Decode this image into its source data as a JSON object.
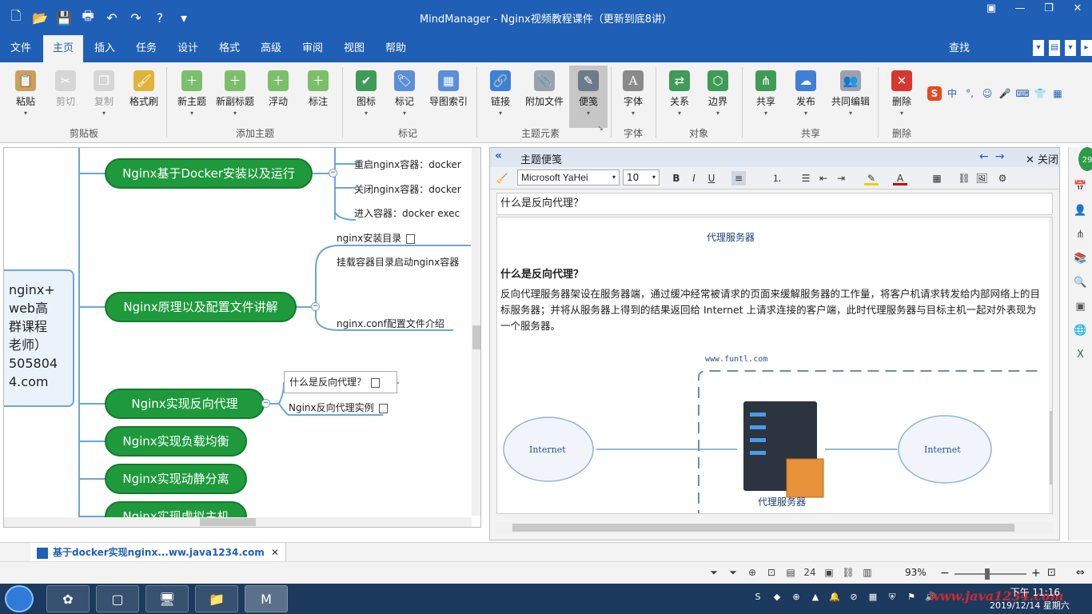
{
  "window": {
    "title": "MindManager - Nginx视频教程课件（更新到底8讲）"
  },
  "menu": {
    "tabs": [
      "文件",
      "主页",
      "插入",
      "任务",
      "设计",
      "格式",
      "高级",
      "审阅",
      "视图",
      "帮助"
    ],
    "active": "主页",
    "find": "查找"
  },
  "ribbon": {
    "buttons": [
      {
        "label": "粘贴",
        "icon": "paste-icon"
      },
      {
        "label": "剪切",
        "icon": "cut-icon"
      },
      {
        "label": "复制",
        "icon": "copy-icon"
      },
      {
        "label": "格式刷",
        "icon": "format-painter-icon"
      },
      {
        "label": "新主题",
        "icon": "new-topic-icon"
      },
      {
        "label": "新副标题",
        "icon": "new-subtopic-icon"
      },
      {
        "label": "浮动",
        "icon": "floating-topic-icon"
      },
      {
        "label": "标注",
        "icon": "callout-icon"
      },
      {
        "label": "图标",
        "icon": "marker-icon"
      },
      {
        "label": "标记",
        "icon": "tag-icon"
      },
      {
        "label": "导图索引",
        "icon": "map-index-icon"
      },
      {
        "label": "链接",
        "icon": "link-icon"
      },
      {
        "label": "附加文件",
        "icon": "attach-icon"
      },
      {
        "label": "便笺",
        "icon": "notes-icon"
      },
      {
        "label": "字体",
        "icon": "font-icon"
      },
      {
        "label": "关系",
        "icon": "relationship-icon"
      },
      {
        "label": "边界",
        "icon": "boundary-icon"
      },
      {
        "label": "共享",
        "icon": "share-icon"
      },
      {
        "label": "发布",
        "icon": "publish-icon"
      },
      {
        "label": "共同编辑",
        "icon": "coedit-icon"
      },
      {
        "label": "删除",
        "icon": "delete-icon"
      }
    ],
    "groups": [
      "剪贴板",
      "添加主题",
      "标记",
      "主题元素",
      "字体",
      "对象",
      "共享",
      "删除"
    ]
  },
  "mindmap": {
    "central_lines": [
      "nginx+",
      "web高",
      "群课程",
      "老师）",
      "505804",
      "4.com"
    ],
    "topics": [
      {
        "label": "Nginx基于Docker安装以及运行"
      },
      {
        "label": "Nginx原理以及配置文件讲解"
      },
      {
        "label": "Nginx实现反向代理"
      },
      {
        "label": "Nginx实现负载均衡"
      },
      {
        "label": "Nginx实现动静分离"
      },
      {
        "label": "Nginx实现虚拟主机"
      }
    ],
    "subtopics": {
      "docker": [
        "重启nginx容器：docker",
        "关闭nginx容器：docker",
        "进入容器：docker exec"
      ],
      "principle": [
        "nginx安装目录",
        "挂载容器目录启动nginx容器",
        "nginx.conf配置文件介绍"
      ],
      "reverse_proxy": [
        "什么是反向代理？",
        "Nginx反向代理实例"
      ]
    }
  },
  "notes": {
    "header": "主题便笺",
    "close": "关闭",
    "font": "Microsoft YaHei",
    "size": "10",
    "subject": "什么是反向代理？",
    "caption_top": "代理服务器",
    "heading": "什么是反向代理？",
    "paragraph": "反向代理服务器架设在服务器端，通过缓冲经常被请求的页面来缓解服务器的工作量，将客户机请求转发给内部网络上的目标服务器；并将从服务器上得到的结果返回给 Internet 上请求连接的客户端，此时代理服务器与目标主机一起对外表现为一个服务器。",
    "diagram": {
      "domain": "www.funtl.com",
      "left_cloud": "Internet",
      "right_cloud": "Internet",
      "server_label": "代理服务器"
    }
  },
  "side_badge": "29",
  "doc_tab": {
    "label": "基于docker实现nginx...ww.java1234.com"
  },
  "status": {
    "zoom": "93%"
  },
  "taskbar": {
    "time": "下午 11:16",
    "date": "2019/12/14 星期六",
    "watermark": "www.java1234.com"
  },
  "colors": {
    "brand": "#1f5fb5",
    "topic_fill": "#1e9a3c",
    "central_border": "#6aa6d8"
  }
}
